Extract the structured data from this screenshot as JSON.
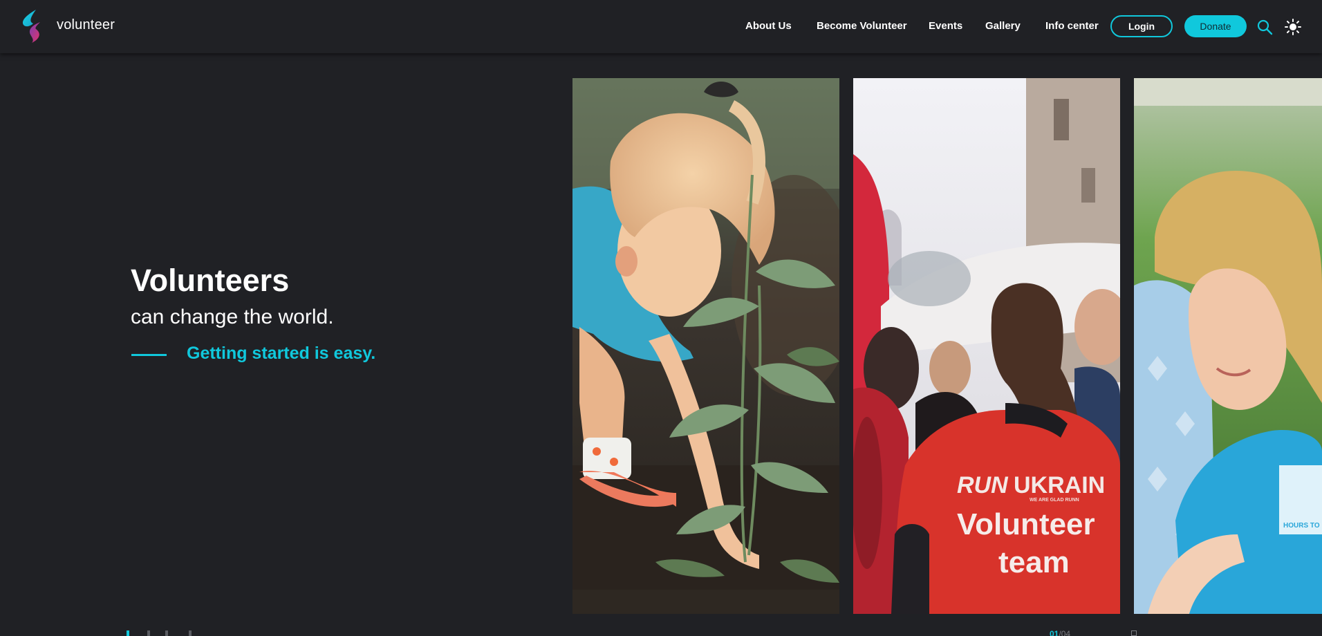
{
  "header": {
    "brand": "volunteer",
    "nav": [
      "About Us",
      "Become Volunteer",
      "Events",
      "Gallery",
      "Info center"
    ],
    "login_label": "Login",
    "donate_label": "Donate",
    "icons": [
      "search-icon",
      "sun-icon"
    ]
  },
  "hero": {
    "title": "Volunteers",
    "subtitle": "can change the world.",
    "cta": "Getting started is easy."
  },
  "gallery": {
    "cards": [
      {
        "name": "photo-child-planting"
      },
      {
        "name": "photo-volunteer-team",
        "shirt_line1": "RUN",
        "shirt_line1b": "UKRAIN",
        "shirt_small": "WE ARE GLAD RUNN",
        "shirt_line2": "Volunteer",
        "shirt_line3": "team"
      },
      {
        "name": "photo-smiling-volunteer",
        "shirt_text": "HOURS TO"
      }
    ],
    "counter_current": "01",
    "counter_total": "/04"
  },
  "colors": {
    "background": "#202125",
    "accent": "#10c8dc",
    "text": "#ffffff"
  }
}
